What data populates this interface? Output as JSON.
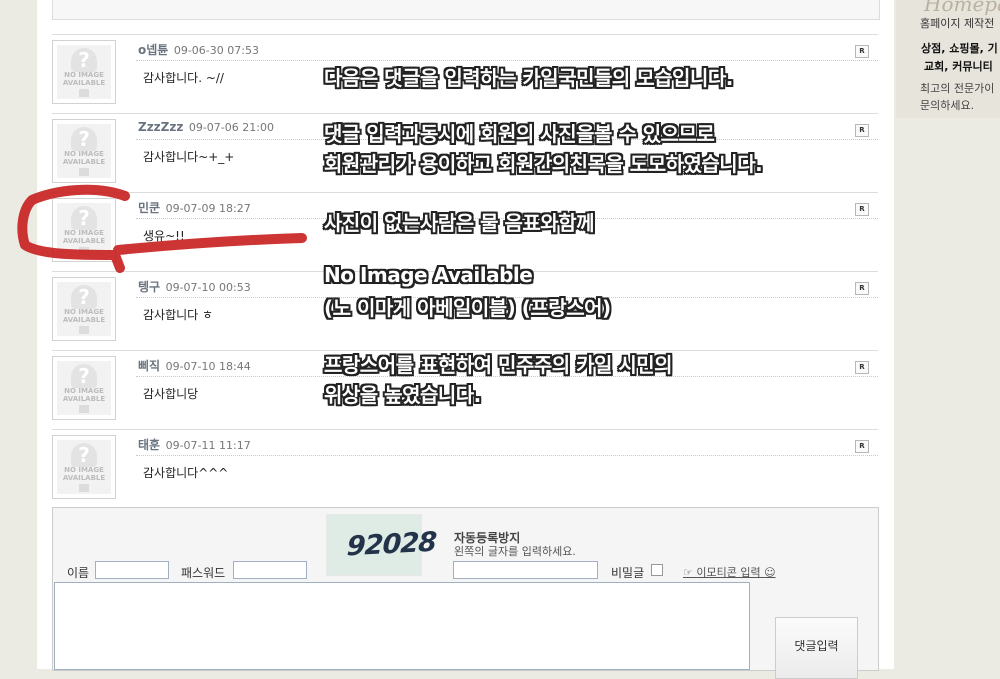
{
  "ad": {
    "script_text": "Homepage",
    "line1": "홈페이지 제작전",
    "line2": "상점, 쇼핑몰, 기",
    "line3": "교회, 커뮤니티",
    "line4": "최고의 전문가이",
    "line5": "문의하세요."
  },
  "comments": [
    {
      "name": "o넵튠",
      "date": "09-06-30 07:53",
      "text": "감사합니다. ~//"
    },
    {
      "name": "ZzzZzz",
      "date": "09-07-06 21:00",
      "text": "감사합니다~+_+"
    },
    {
      "name": "민쿤",
      "date": "09-07-09 18:27",
      "text": "생유~!!"
    },
    {
      "name": "텡구",
      "date": "09-07-10 00:53",
      "text": "감사합니다 ㅎ"
    },
    {
      "name": "삐직",
      "date": "09-07-10 18:44",
      "text": "감사합니당"
    },
    {
      "name": "태훈",
      "date": "09-07-11 11:17",
      "text": "감사합니다^^^"
    }
  ],
  "reply_label": "R",
  "avatar_text": {
    "line1": "NO IMAGE",
    "line2": "AVAILABLE"
  },
  "annotations": [
    "다음은 댓글을 입력하는 카일국민들의 모습입니다.",
    "댓글 입력과동시에 회원의 사진을볼 수 있으므로",
    "회원관리가 용이하고 회원간의친목을 도모하였습니다.",
    "사진이 없는사람은 물 음표와함께",
    "No Image Available",
    "(노 이마게 아베일이블) (프랑스어)",
    "프랑스어를 표현하여 민주주의 카일 시민의",
    "위상을 높였습니다."
  ],
  "form": {
    "captcha_code": "92028",
    "antispam_title": "자동등록방지",
    "antispam_desc": "왼쪽의 글자를 입력하세요.",
    "name_label": "이름",
    "password_label": "패스워드",
    "secret_label": "비밀글",
    "emoticon_label": "이모티콘 입력",
    "submit_label": "댓글입력",
    "name_value": "",
    "password_value": "",
    "captcha_value": "",
    "comment_value": ""
  },
  "colors": {
    "highlight_mark": "#c81e1e",
    "annotation_text": "#ffffff"
  }
}
